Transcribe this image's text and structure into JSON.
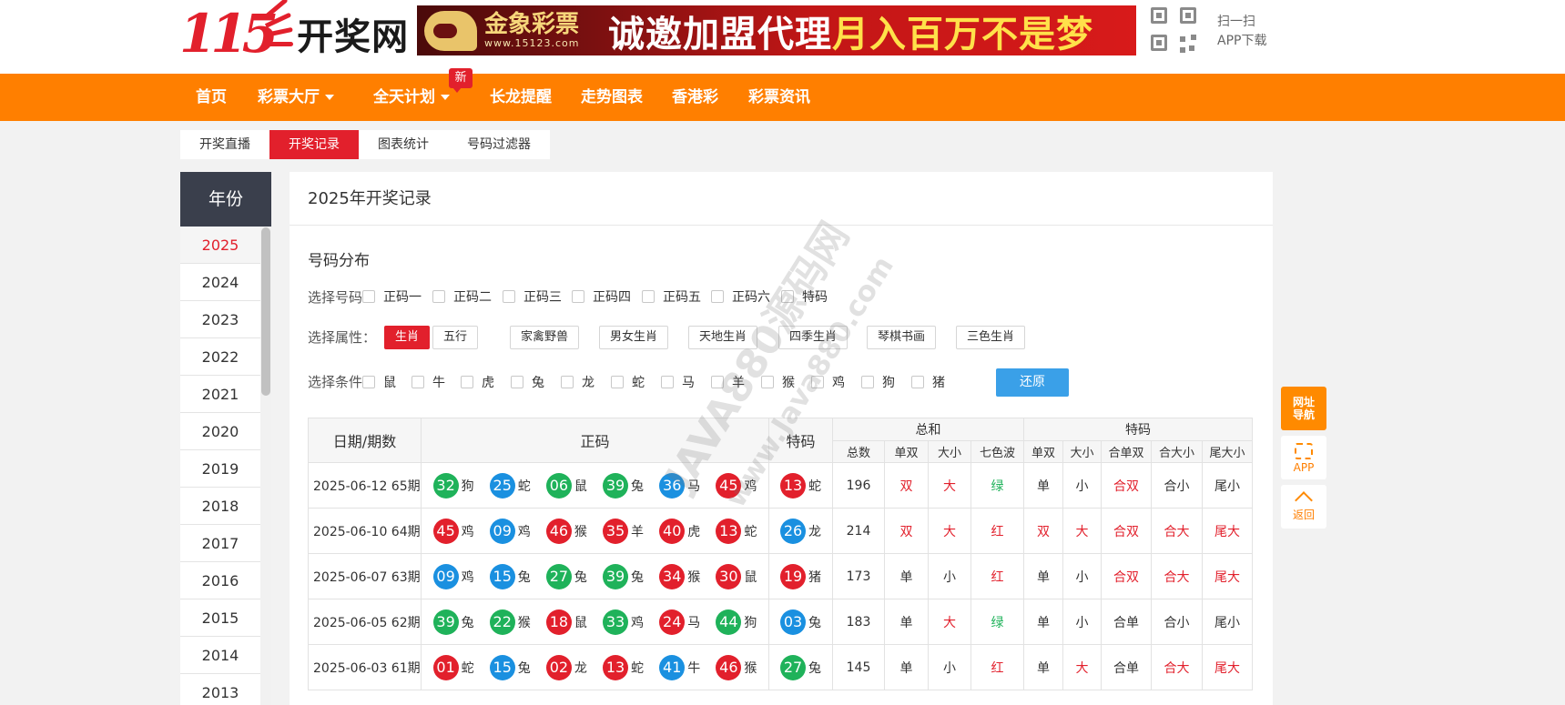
{
  "header": {
    "logo_num": "115",
    "logo_text": "开奖网",
    "banner_brand": "金象彩票",
    "banner_url": "www.15123.com",
    "banner_slogan": "诚邀加盟代理",
    "banner_slogan2": "月入百万不是梦",
    "qr_line1": "扫一扫",
    "qr_line2": "APP下载"
  },
  "nav": {
    "items": [
      "首页",
      "彩票大厅",
      "全天计划",
      "长龙提醒",
      "走势图表",
      "香港彩",
      "彩票资讯"
    ],
    "new_badge": "新"
  },
  "subtabs": [
    "开奖直播",
    "开奖记录",
    "图表统计",
    "号码过滤器"
  ],
  "sidebar": {
    "heading": "年份",
    "years": [
      "2025",
      "2024",
      "2023",
      "2022",
      "2021",
      "2020",
      "2019",
      "2018",
      "2017",
      "2016",
      "2015",
      "2014",
      "2013"
    ]
  },
  "panel": {
    "title": "2025年开奖记录",
    "section_title": "号码分布",
    "select_number_label": "选择号码：",
    "number_options": [
      "正码一",
      "正码二",
      "正码三",
      "正码四",
      "正码五",
      "正码六",
      "特码"
    ],
    "select_attr_label": "选择属性：",
    "attr_options": [
      "生肖",
      "五行",
      "家禽野兽",
      "男女生肖",
      "天地生肖",
      "四季生肖",
      "琴棋书画",
      "三色生肖"
    ],
    "select_cond_label": "选择条件：",
    "cond_options": [
      "鼠",
      "牛",
      "虎",
      "兔",
      "龙",
      "蛇",
      "马",
      "羊",
      "猴",
      "鸡",
      "狗",
      "猪"
    ],
    "reset_label": "还原"
  },
  "table": {
    "headers": {
      "date": "日期/期数",
      "zhengma": "正码",
      "tema": "特码",
      "zonghe": "总和",
      "tema_group": "特码",
      "zonghe_sub": [
        "总数",
        "单双",
        "大小",
        "七色波"
      ],
      "tema_sub": [
        "单双",
        "大小",
        "合单双",
        "合大小",
        "尾大小"
      ]
    },
    "rows": [
      {
        "date": "2025-06-12 65期",
        "balls": [
          {
            "num": "32",
            "zodiac": "狗",
            "color": "green"
          },
          {
            "num": "25",
            "zodiac": "蛇",
            "color": "blue"
          },
          {
            "num": "06",
            "zodiac": "鼠",
            "color": "green"
          },
          {
            "num": "39",
            "zodiac": "兔",
            "color": "green"
          },
          {
            "num": "36",
            "zodiac": "马",
            "color": "blue"
          },
          {
            "num": "45",
            "zodiac": "鸡",
            "color": "red"
          }
        ],
        "special": {
          "num": "13",
          "zodiac": "蛇",
          "color": "red"
        },
        "total": "196",
        "stats": [
          {
            "v": "双",
            "c": "red"
          },
          {
            "v": "大",
            "c": "red"
          },
          {
            "v": "绿",
            "c": "green"
          },
          {
            "v": "单",
            "c": ""
          },
          {
            "v": "小",
            "c": ""
          },
          {
            "v": "合双",
            "c": "red"
          },
          {
            "v": "合小",
            "c": ""
          },
          {
            "v": "尾小",
            "c": ""
          }
        ]
      },
      {
        "date": "2025-06-10 64期",
        "balls": [
          {
            "num": "45",
            "zodiac": "鸡",
            "color": "red"
          },
          {
            "num": "09",
            "zodiac": "鸡",
            "color": "blue"
          },
          {
            "num": "46",
            "zodiac": "猴",
            "color": "red"
          },
          {
            "num": "35",
            "zodiac": "羊",
            "color": "red"
          },
          {
            "num": "40",
            "zodiac": "虎",
            "color": "red"
          },
          {
            "num": "13",
            "zodiac": "蛇",
            "color": "red"
          }
        ],
        "special": {
          "num": "26",
          "zodiac": "龙",
          "color": "blue"
        },
        "total": "214",
        "stats": [
          {
            "v": "双",
            "c": "red"
          },
          {
            "v": "大",
            "c": "red"
          },
          {
            "v": "红",
            "c": "red"
          },
          {
            "v": "双",
            "c": "red"
          },
          {
            "v": "大",
            "c": "red"
          },
          {
            "v": "合双",
            "c": "red"
          },
          {
            "v": "合大",
            "c": "red"
          },
          {
            "v": "尾大",
            "c": "red"
          }
        ]
      },
      {
        "date": "2025-06-07 63期",
        "balls": [
          {
            "num": "09",
            "zodiac": "鸡",
            "color": "blue"
          },
          {
            "num": "15",
            "zodiac": "兔",
            "color": "blue"
          },
          {
            "num": "27",
            "zodiac": "兔",
            "color": "green"
          },
          {
            "num": "39",
            "zodiac": "兔",
            "color": "green"
          },
          {
            "num": "34",
            "zodiac": "猴",
            "color": "red"
          },
          {
            "num": "30",
            "zodiac": "鼠",
            "color": "red"
          }
        ],
        "special": {
          "num": "19",
          "zodiac": "猪",
          "color": "red"
        },
        "total": "173",
        "stats": [
          {
            "v": "单",
            "c": ""
          },
          {
            "v": "小",
            "c": ""
          },
          {
            "v": "红",
            "c": "red"
          },
          {
            "v": "单",
            "c": ""
          },
          {
            "v": "小",
            "c": ""
          },
          {
            "v": "合双",
            "c": "red"
          },
          {
            "v": "合大",
            "c": "red"
          },
          {
            "v": "尾大",
            "c": "red"
          }
        ]
      },
      {
        "date": "2025-06-05 62期",
        "balls": [
          {
            "num": "39",
            "zodiac": "兔",
            "color": "green"
          },
          {
            "num": "22",
            "zodiac": "猴",
            "color": "green"
          },
          {
            "num": "18",
            "zodiac": "鼠",
            "color": "red"
          },
          {
            "num": "33",
            "zodiac": "鸡",
            "color": "green"
          },
          {
            "num": "24",
            "zodiac": "马",
            "color": "red"
          },
          {
            "num": "44",
            "zodiac": "狗",
            "color": "green"
          }
        ],
        "special": {
          "num": "03",
          "zodiac": "兔",
          "color": "blue"
        },
        "total": "183",
        "stats": [
          {
            "v": "单",
            "c": ""
          },
          {
            "v": "大",
            "c": "red"
          },
          {
            "v": "绿",
            "c": "green"
          },
          {
            "v": "单",
            "c": ""
          },
          {
            "v": "小",
            "c": ""
          },
          {
            "v": "合单",
            "c": ""
          },
          {
            "v": "合小",
            "c": ""
          },
          {
            "v": "尾小",
            "c": ""
          }
        ]
      },
      {
        "date": "2025-06-03 61期",
        "balls": [
          {
            "num": "01",
            "zodiac": "蛇",
            "color": "red"
          },
          {
            "num": "15",
            "zodiac": "兔",
            "color": "blue"
          },
          {
            "num": "02",
            "zodiac": "龙",
            "color": "red"
          },
          {
            "num": "13",
            "zodiac": "蛇",
            "color": "red"
          },
          {
            "num": "41",
            "zodiac": "牛",
            "color": "blue"
          },
          {
            "num": "46",
            "zodiac": "猴",
            "color": "red"
          }
        ],
        "special": {
          "num": "27",
          "zodiac": "兔",
          "color": "green"
        },
        "total": "145",
        "stats": [
          {
            "v": "单",
            "c": ""
          },
          {
            "v": "小",
            "c": ""
          },
          {
            "v": "红",
            "c": "red"
          },
          {
            "v": "单",
            "c": ""
          },
          {
            "v": "大",
            "c": "red"
          },
          {
            "v": "合单",
            "c": ""
          },
          {
            "v": "合大",
            "c": "red"
          },
          {
            "v": "尾大",
            "c": "red"
          }
        ]
      }
    ]
  },
  "watermark": {
    "line1": "JAVA880源码网",
    "line2": "www.Java880.com"
  },
  "floats": {
    "nav_line1": "网址",
    "nav_line2": "导航",
    "app": "APP",
    "back": "返回"
  },
  "colors": {
    "brand_red": "#e2202c",
    "nav_orange": "#ff7f00",
    "ball_red": "#e2202c",
    "ball_blue": "#1a90e0",
    "ball_green": "#1fb25a",
    "reset_blue": "#3aa0e8"
  }
}
